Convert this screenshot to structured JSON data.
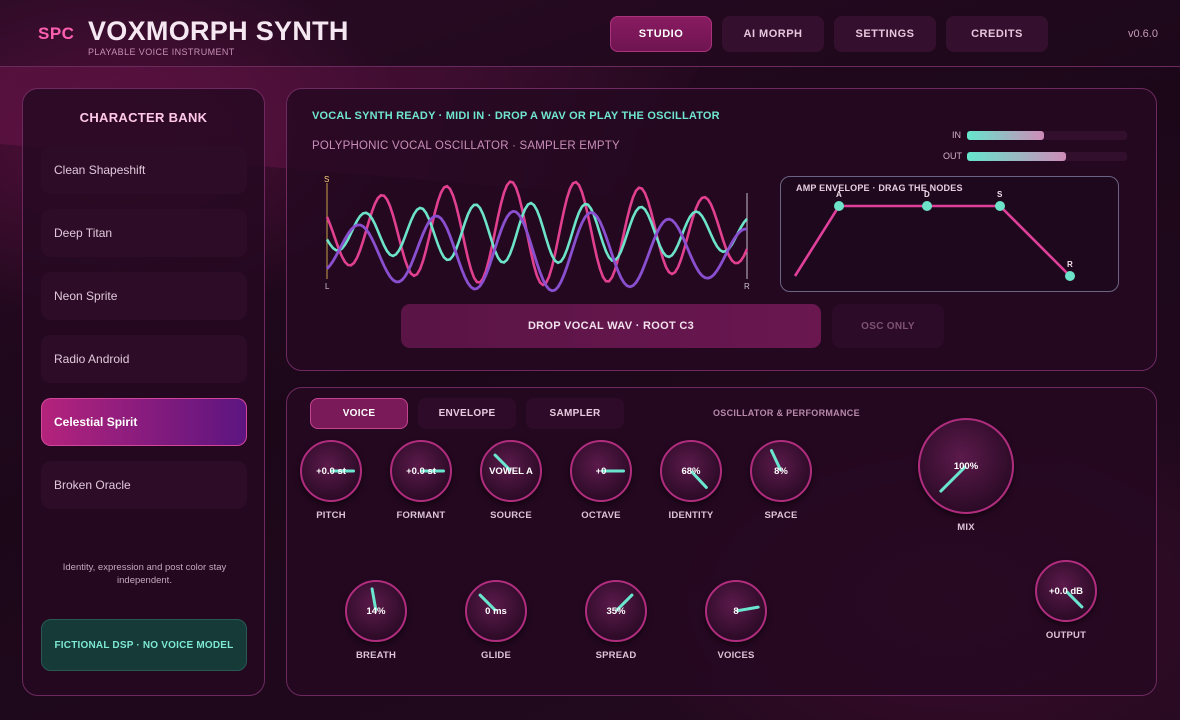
{
  "header": {
    "brand_mark": "SPC",
    "title": "VOXMORPH SYNTH",
    "subtitle": "PLAYABLE VOICE INSTRUMENT",
    "version": "v0.6.0",
    "tabs": [
      {
        "label": "STUDIO",
        "active": true
      },
      {
        "label": "AI MORPH",
        "active": false
      },
      {
        "label": "SETTINGS",
        "active": false
      },
      {
        "label": "CREDITS",
        "active": false
      }
    ]
  },
  "bank": {
    "title": "CHARACTER BANK",
    "items": [
      {
        "label": "Clean Shapeshift",
        "active": false
      },
      {
        "label": "Deep Titan",
        "active": false
      },
      {
        "label": "Neon Sprite",
        "active": false
      },
      {
        "label": "Radio Android",
        "active": false
      },
      {
        "label": "Celestial Spirit",
        "active": true
      },
      {
        "label": "Broken Oracle",
        "active": false
      }
    ],
    "note": "Identity, expression and post color stay independent.",
    "footer": "FICTIONAL DSP · NO VOICE MODEL"
  },
  "visualizer": {
    "status": "VOCAL SYNTH READY · MIDI IN · DROP A WAV OR PLAY THE OSCILLATOR",
    "sub_status": "POLYPHONIC VOCAL OSCILLATOR · SAMPLER EMPTY",
    "meters": [
      {
        "label": "IN",
        "level": 0.48
      },
      {
        "label": "OUT",
        "level": 0.62
      }
    ],
    "wave_markers": {
      "start": "S",
      "left": "L",
      "right": "R"
    },
    "envelope": {
      "label": "AMP ENVELOPE · DRAG THE NODES",
      "nodes": [
        "A",
        "D",
        "S",
        "R"
      ]
    },
    "drop_button": "DROP VOCAL WAV · ROOT C3",
    "osc_button": "OSC ONLY"
  },
  "controls": {
    "tabs": [
      {
        "label": "VOICE",
        "active": true
      },
      {
        "label": "ENVELOPE",
        "active": false
      },
      {
        "label": "SAMPLER",
        "active": false
      }
    ],
    "section_label": "OSCILLATOR & PERFORMANCE",
    "knobs": [
      {
        "id": "pitch",
        "label": "PITCH",
        "value": "+0.0 st",
        "angle": 0
      },
      {
        "id": "formant",
        "label": "FORMANT",
        "value": "+0.0 st",
        "angle": 0
      },
      {
        "id": "source",
        "label": "SOURCE",
        "value": "VOWEL A",
        "angle": -135
      },
      {
        "id": "octave",
        "label": "OCTAVE",
        "value": "+0",
        "angle": 0
      },
      {
        "id": "identity",
        "label": "IDENTITY",
        "value": "68%",
        "angle": 47
      },
      {
        "id": "space",
        "label": "SPACE",
        "value": "8%",
        "angle": -115
      },
      {
        "id": "mix",
        "label": "MIX",
        "value": "100%",
        "angle": 135
      },
      {
        "id": "breath",
        "label": "BREATH",
        "value": "14%",
        "angle": -100
      },
      {
        "id": "glide",
        "label": "GLIDE",
        "value": "0 ms",
        "angle": -135
      },
      {
        "id": "spread",
        "label": "SPREAD",
        "value": "35%",
        "angle": -45
      },
      {
        "id": "voices",
        "label": "VOICES",
        "value": "8",
        "angle": -10
      },
      {
        "id": "output",
        "label": "OUTPUT",
        "value": "+0.0 dB",
        "angle": 45
      }
    ]
  }
}
